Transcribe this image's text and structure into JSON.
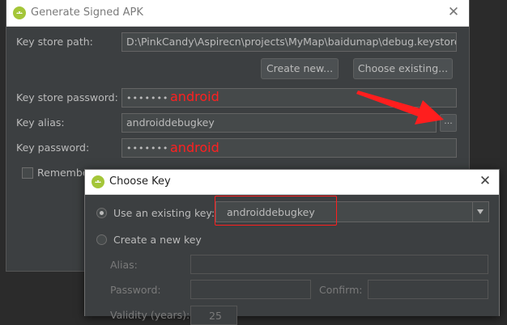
{
  "main_dialog": {
    "title": "Generate Signed APK",
    "key_store_path_label": "Key store path:",
    "key_store_path_value": "D:\\PinkCandy\\Aspirecn\\projects\\MyMap\\baidumap\\debug.keystore",
    "create_new_label": "Create new...",
    "choose_existing_label": "Choose existing...",
    "key_store_password_label": "Key store password:",
    "key_store_password_value": "•••••••",
    "key_store_password_note": "android",
    "key_alias_label": "Key alias:",
    "key_alias_value": "androiddebugkey",
    "browse_label": "...",
    "key_password_label": "Key password:",
    "key_password_value": "•••••••",
    "key_password_note": "android",
    "remember_label": "Remembe"
  },
  "choose_key_dialog": {
    "title": "Choose Key",
    "use_existing_label": "Use an existing key:",
    "existing_key_value": "androiddebugkey",
    "create_new_key_label": "Create a new key",
    "alias_label": "Alias:",
    "password_label": "Password:",
    "confirm_label": "Confirm:",
    "validity_label": "Validity (years):",
    "validity_value": "25"
  },
  "icons": {
    "app": "android-icon",
    "close": "close-icon",
    "arrow": "red-arrow-annotation"
  },
  "colors": {
    "annotation_red": "#ff1e1e",
    "panel_bg": "#3c3f41",
    "android_green": "#a4c639"
  }
}
